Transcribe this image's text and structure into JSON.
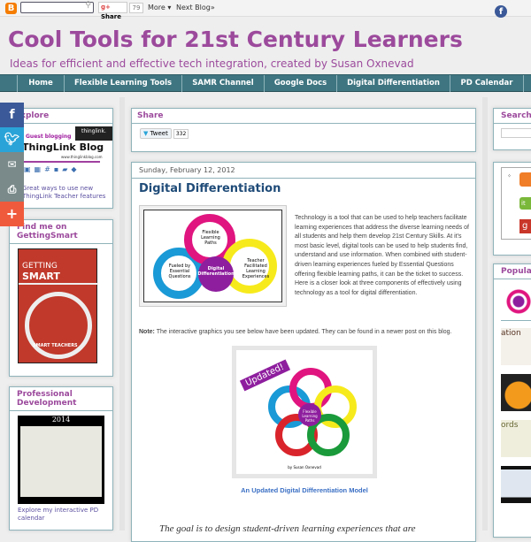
{
  "topbar": {
    "share_label": "Share",
    "share_count": "79",
    "more_label": "More ▾",
    "next_blog_label": "Next Blog»",
    "search_placeholder": ""
  },
  "header": {
    "title": "Cool Tools for 21st Century Learners",
    "subtitle": "Ideas for efficient and effective tech integration, created by Susan Oxnevad"
  },
  "nav": {
    "items": [
      "Home",
      "Flexible Learning Tools",
      "SAMR Channel",
      "Google Docs",
      "Digital Differentiation",
      "PD Calendar"
    ]
  },
  "social_bar": {
    "icons": [
      "facebook-icon",
      "twitter-icon",
      "email-icon",
      "print-icon",
      "plus-icon"
    ],
    "colors": [
      "#3b5998",
      "#2aa4d8",
      "#7a8a8a",
      "#7a8a8a",
      "#f05a3c"
    ]
  },
  "left": {
    "explore": {
      "title": "Explore",
      "image_heading": "ThingLink Blog",
      "image_tag": "Guest blogging",
      "image_badge": "thinglink.",
      "image_url_text": "www.thinglinkblog.com",
      "caption": "Great ways to use new ThingLink Teacher features"
    },
    "gettingsmart": {
      "title": "Find me on GettingSmart",
      "image_line1": "GETTING",
      "image_line2": "SMART",
      "image_banner": "SMART TEACHERS"
    },
    "pd": {
      "title": "Professional Development",
      "image_year": "2014",
      "caption": "Explore my interactive PD calendar"
    }
  },
  "main": {
    "share": {
      "title": "Share",
      "tweet_label": "Tweet",
      "tweet_count": "332"
    },
    "post": {
      "date": "Sunday, February 12, 2012",
      "title": "Digital Differentiation",
      "diagram": {
        "center": "Digital Differentiation",
        "left": "Fueled by Essential Questions",
        "top": "Flexible Learning Paths",
        "right": "Teacher Facilitated Learning Experiences"
      },
      "intro": "Technology is a tool that can be used to help teachers facilitate learning experiences that address the diverse learning needs of all students and help them develop 21st Century Skills. At it's most basic level, digital tools can be used to help students find, understand and use information. When combined with student-driven learning experiences fueled by Essential Questions offering flexible learning paths, it can be the ticket to success. Here is a closer look at three components of effectively using technology as a tool for digital differentiation.",
      "note_label": "Note:",
      "note_text": " The interactive graphics you see below have been updated. They can be found in a newer post on this blog.",
      "updated_image": {
        "banner": "Updated!",
        "center": "Flexible Learning Paths",
        "credit": "by Susan Oxnevad"
      },
      "caption_link": "An Updated Digital Differentiation Model",
      "quote": "The goal is to design student-driven learning experiences that are"
    }
  },
  "right": {
    "search_title": "Search",
    "popular_title": "Popular"
  },
  "colors": {
    "title": "#9c4a9c",
    "nav": "#3e7581",
    "post_title": "#1f4b78",
    "link": "#3a6fc4"
  }
}
